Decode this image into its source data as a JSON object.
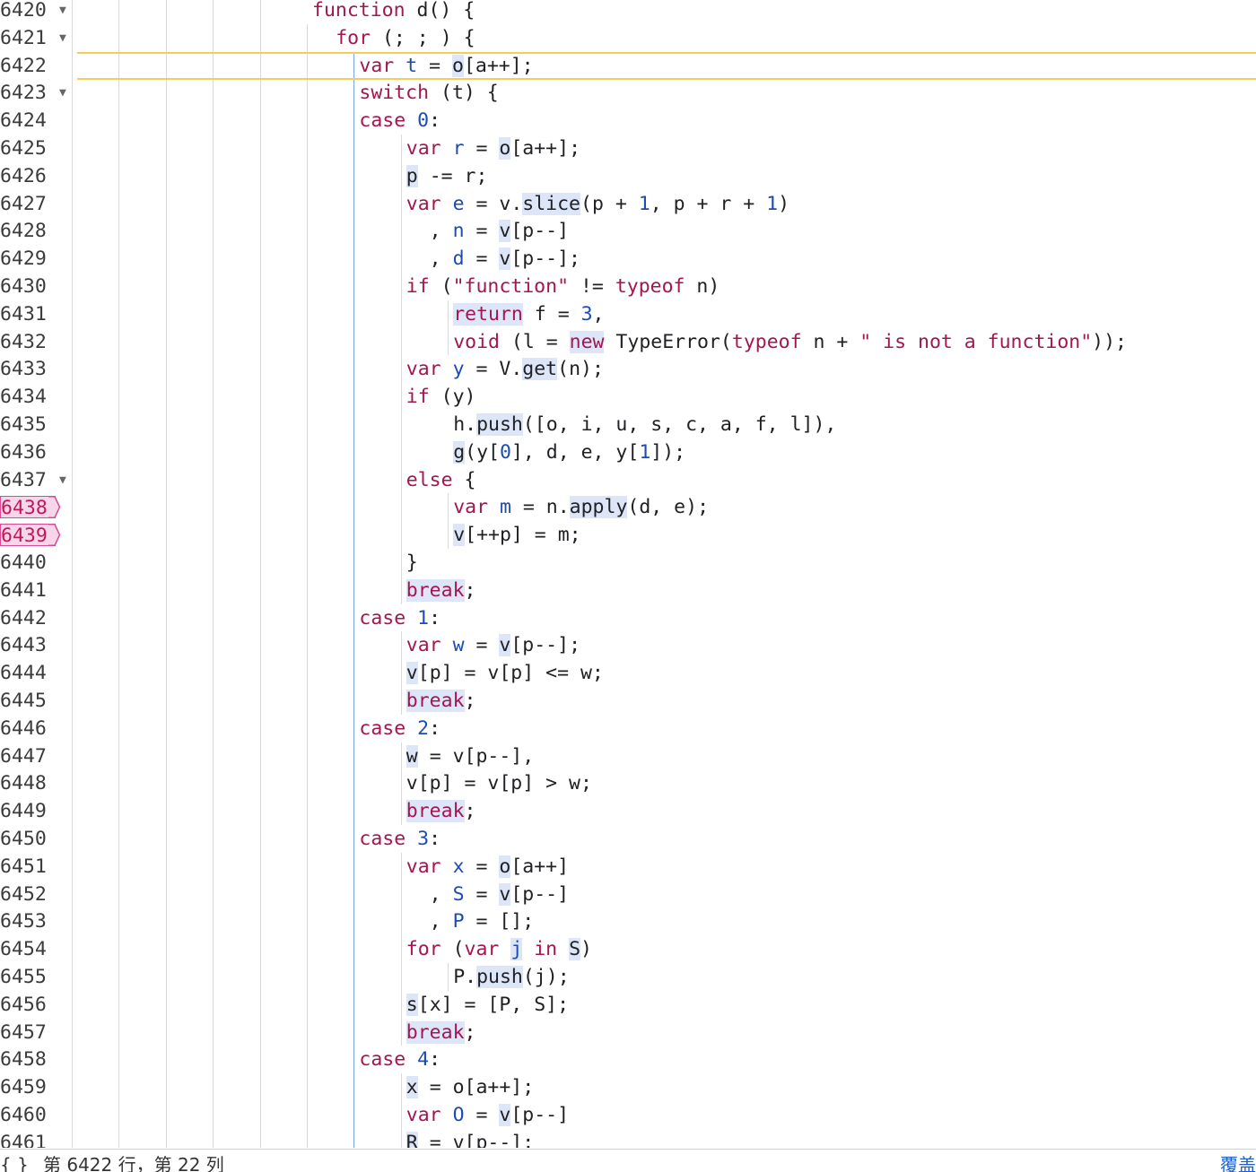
{
  "editor": {
    "first_line": 6420,
    "current_line": 6422,
    "breakpoints": [
      6438,
      6439
    ],
    "fold_markers": [
      6420,
      6421,
      6423,
      6437
    ],
    "lines": [
      [
        [
          "d",
          "function",
          "kw"
        ],
        [
          "p",
          " "
        ],
        [
          "p",
          "d"
        ],
        [
          "p",
          "() {"
        ]
      ],
      [
        [
          "d",
          "for",
          "kw"
        ],
        [
          "p",
          " (; ; ) {"
        ]
      ],
      [
        [
          "d",
          "var",
          "kw"
        ],
        [
          "p",
          " "
        ],
        [
          "p",
          "t",
          "vdef"
        ],
        [
          "p",
          " = "
        ],
        [
          "c",
          ""
        ],
        [
          "p",
          "o",
          "hl"
        ],
        [
          "p",
          "[a++];"
        ]
      ],
      [
        [
          "d",
          "switch",
          "kw"
        ],
        [
          "p",
          " (t) {"
        ]
      ],
      [
        [
          "d",
          "case",
          "kw"
        ],
        [
          "p",
          " "
        ],
        [
          "p",
          "0",
          "num"
        ],
        [
          "p",
          ":"
        ]
      ],
      [
        [
          "d",
          "var",
          "kw"
        ],
        [
          "p",
          " "
        ],
        [
          "p",
          "r",
          "vdef"
        ],
        [
          "p",
          " = "
        ],
        [
          "p",
          "o",
          "hl"
        ],
        [
          "p",
          "[a++];"
        ]
      ],
      [
        [
          "p",
          "p",
          "hl"
        ],
        [
          "p",
          " -= r;"
        ]
      ],
      [
        [
          "d",
          "var",
          "kw"
        ],
        [
          "p",
          " "
        ],
        [
          "p",
          "e",
          "vdef"
        ],
        [
          "p",
          " = v."
        ],
        [
          "p",
          "slice",
          "hl"
        ],
        [
          "p",
          "(p + "
        ],
        [
          "p",
          "1",
          "num"
        ],
        [
          "p",
          ", p + r + "
        ],
        [
          "p",
          "1",
          "num"
        ],
        [
          "p",
          ")"
        ]
      ],
      [
        [
          "p",
          "  , "
        ],
        [
          "p",
          "n",
          "vdef"
        ],
        [
          "p",
          " = "
        ],
        [
          "p",
          "v",
          "hl"
        ],
        [
          "p",
          "[p--]"
        ]
      ],
      [
        [
          "p",
          "  , "
        ],
        [
          "p",
          "d",
          "vdef"
        ],
        [
          "p",
          " = "
        ],
        [
          "p",
          "v",
          "hl"
        ],
        [
          "p",
          "[p--];"
        ]
      ],
      [
        [
          "d",
          "if",
          "kw"
        ],
        [
          "p",
          " ("
        ],
        [
          "p",
          "\"function\"",
          "str"
        ],
        [
          "p",
          " != "
        ],
        [
          "p",
          "typeof",
          "kw"
        ],
        [
          "p",
          " n)"
        ]
      ],
      [
        [
          "p",
          "return",
          "kw hl"
        ],
        [
          "p",
          " f = "
        ],
        [
          "p",
          "3",
          "num"
        ],
        [
          "p",
          ","
        ]
      ],
      [
        [
          "p",
          "void",
          "kw"
        ],
        [
          "p",
          " (l = "
        ],
        [
          "p",
          "new",
          "kw hl"
        ],
        [
          "p",
          " TypeError("
        ],
        [
          "p",
          "typeof",
          "kw"
        ],
        [
          "p",
          " n + "
        ],
        [
          "p",
          "\" is not a function\"",
          "str"
        ],
        [
          "p",
          "));"
        ]
      ],
      [
        [
          "d",
          "var",
          "kw"
        ],
        [
          "p",
          " "
        ],
        [
          "p",
          "y",
          "vdef"
        ],
        [
          "p",
          " = V."
        ],
        [
          "p",
          "get",
          "hl"
        ],
        [
          "p",
          "(n);"
        ]
      ],
      [
        [
          "d",
          "if",
          "kw"
        ],
        [
          "p",
          " (y)"
        ]
      ],
      [
        [
          "p",
          "h."
        ],
        [
          "p",
          "push",
          "hl"
        ],
        [
          "p",
          "([o, i, u, s, c, a, f, l]),"
        ]
      ],
      [
        [
          "p",
          "g",
          "hl"
        ],
        [
          "p",
          "(y["
        ],
        [
          "p",
          "0",
          "num"
        ],
        [
          "p",
          "], d, e, y["
        ],
        [
          "p",
          "1",
          "num"
        ],
        [
          "p",
          "]);"
        ]
      ],
      [
        [
          "d",
          "else",
          "kw"
        ],
        [
          "p",
          " {"
        ]
      ],
      [
        [
          "d",
          "var",
          "kw"
        ],
        [
          "p",
          " "
        ],
        [
          "p",
          "m",
          "vdef"
        ],
        [
          "p",
          " = n."
        ],
        [
          "p",
          "apply",
          "hl"
        ],
        [
          "p",
          "(d, e);"
        ]
      ],
      [
        [
          "p",
          "v",
          "hl"
        ],
        [
          "p",
          "[++p] = m;"
        ]
      ],
      [
        [
          "p",
          "}"
        ]
      ],
      [
        [
          "p",
          "break",
          "kw hl"
        ],
        [
          "p",
          ";"
        ]
      ],
      [
        [
          "d",
          "case",
          "kw"
        ],
        [
          "p",
          " "
        ],
        [
          "p",
          "1",
          "num"
        ],
        [
          "p",
          ":"
        ]
      ],
      [
        [
          "d",
          "var",
          "kw"
        ],
        [
          "p",
          " "
        ],
        [
          "p",
          "w",
          "vdef"
        ],
        [
          "p",
          " = "
        ],
        [
          "p",
          "v",
          "hl"
        ],
        [
          "p",
          "[p--];"
        ]
      ],
      [
        [
          "p",
          "v",
          "hl"
        ],
        [
          "p",
          "[p] = v[p] <= w;"
        ]
      ],
      [
        [
          "p",
          "break",
          "kw hl"
        ],
        [
          "p",
          ";"
        ]
      ],
      [
        [
          "d",
          "case",
          "kw"
        ],
        [
          "p",
          " "
        ],
        [
          "p",
          "2",
          "num"
        ],
        [
          "p",
          ":"
        ]
      ],
      [
        [
          "p",
          "w",
          "hl"
        ],
        [
          "p",
          " = v[p--],"
        ]
      ],
      [
        [
          "p",
          "v[p] = v[p] > w;"
        ]
      ],
      [
        [
          "p",
          "break",
          "kw hl"
        ],
        [
          "p",
          ";"
        ]
      ],
      [
        [
          "d",
          "case",
          "kw"
        ],
        [
          "p",
          " "
        ],
        [
          "p",
          "3",
          "num"
        ],
        [
          "p",
          ":"
        ]
      ],
      [
        [
          "d",
          "var",
          "kw"
        ],
        [
          "p",
          " "
        ],
        [
          "p",
          "x",
          "vdef"
        ],
        [
          "p",
          " = "
        ],
        [
          "p",
          "o",
          "hl"
        ],
        [
          "p",
          "[a++]"
        ]
      ],
      [
        [
          "p",
          "  , "
        ],
        [
          "p",
          "S",
          "vdef"
        ],
        [
          "p",
          " = "
        ],
        [
          "p",
          "v",
          "hl"
        ],
        [
          "p",
          "[p--]"
        ]
      ],
      [
        [
          "p",
          "  , "
        ],
        [
          "p",
          "P",
          "vdef"
        ],
        [
          "p",
          " = [];"
        ]
      ],
      [
        [
          "d",
          "for",
          "kw"
        ],
        [
          "p",
          " ("
        ],
        [
          "p",
          "var",
          "kw"
        ],
        [
          "p",
          " "
        ],
        [
          "p",
          "j",
          "vdef hl"
        ],
        [
          "p",
          " "
        ],
        [
          "p",
          "in",
          "kw"
        ],
        [
          "p",
          " "
        ],
        [
          "p",
          "S",
          "hl"
        ],
        [
          "p",
          ")"
        ]
      ],
      [
        [
          "p",
          "P."
        ],
        [
          "p",
          "push",
          "hl"
        ],
        [
          "p",
          "(j);"
        ]
      ],
      [
        [
          "p",
          "s",
          "hl"
        ],
        [
          "p",
          "[x] = [P, S];"
        ]
      ],
      [
        [
          "p",
          "break",
          "kw hl"
        ],
        [
          "p",
          ";"
        ]
      ],
      [
        [
          "d",
          "case",
          "kw"
        ],
        [
          "p",
          " "
        ],
        [
          "p",
          "4",
          "num"
        ],
        [
          "p",
          ":"
        ]
      ],
      [
        [
          "p",
          "x",
          "hl"
        ],
        [
          "p",
          " = o[a++];"
        ]
      ],
      [
        [
          "d",
          "var",
          "kw"
        ],
        [
          "p",
          " "
        ],
        [
          "p",
          "O",
          "vdef"
        ],
        [
          "p",
          " = "
        ],
        [
          "p",
          "v",
          "hl"
        ],
        [
          "p",
          "[p--]"
        ]
      ],
      [
        [
          "p",
          "R",
          "hl"
        ],
        [
          "p",
          " = v[p--];"
        ]
      ]
    ]
  },
  "status_bar": {
    "brackets": "{ }",
    "position": "第 6422 行，第 22 列",
    "right_link": "覆盖"
  }
}
